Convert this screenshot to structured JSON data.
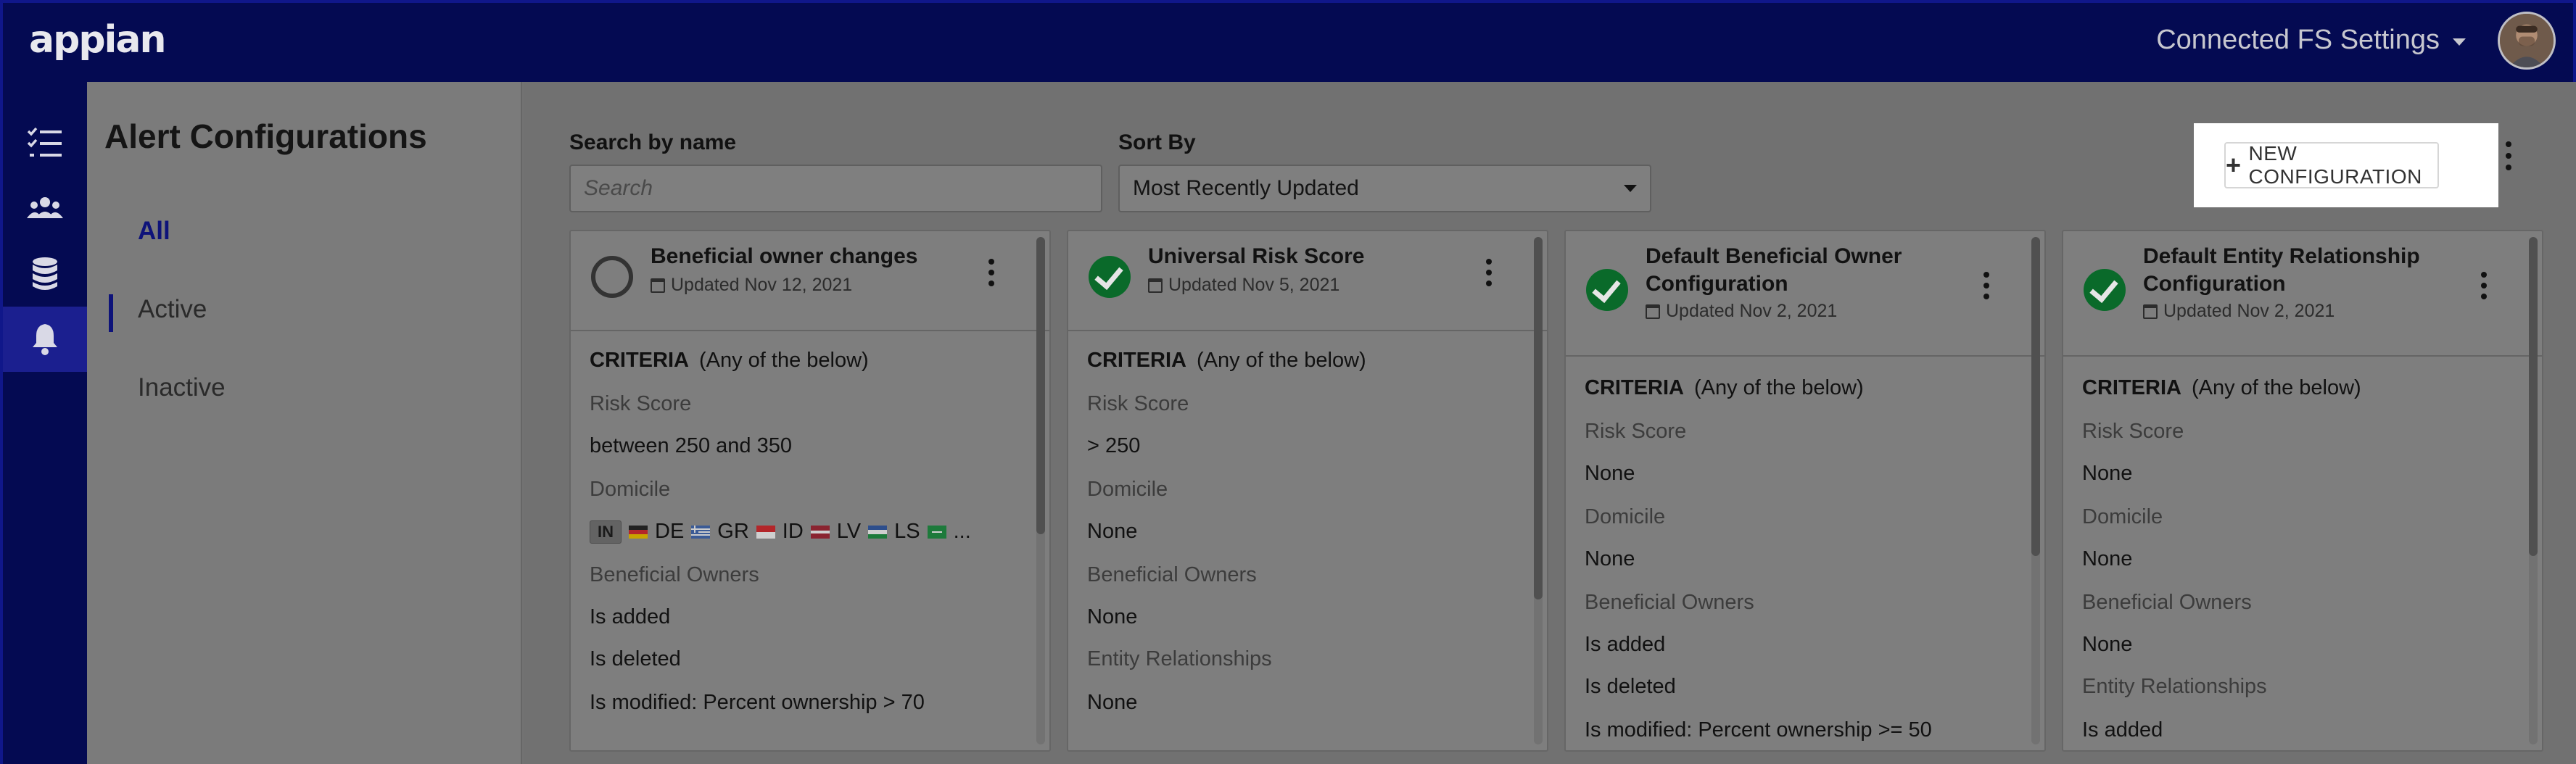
{
  "header": {
    "logo": "appian",
    "settings_label": "Connected FS Settings"
  },
  "rail": {
    "items": [
      {
        "icon": "checklist-icon",
        "active": false
      },
      {
        "icon": "users-icon",
        "active": false
      },
      {
        "icon": "database-icon",
        "active": false
      },
      {
        "icon": "bell-icon",
        "active": true
      }
    ]
  },
  "leftnav": {
    "title": "Alert Configurations",
    "items": [
      {
        "label": "All",
        "selected": true
      },
      {
        "label": "Active",
        "selected": false
      },
      {
        "label": "Inactive",
        "selected": false
      }
    ]
  },
  "toolbar": {
    "search_label": "Search by name",
    "search_placeholder": "Search",
    "sort_label": "Sort By",
    "sort_value": "Most Recently Updated",
    "new_button_label": "NEW CONFIGURATION"
  },
  "cards": [
    {
      "title": "Beneficial owner changes",
      "status": "inactive",
      "updated": "Updated Nov 12, 2021",
      "criteria_label": "CRITERIA",
      "criteria_qualifier": "(Any of the below)",
      "sections": [
        {
          "heading": "Risk Score",
          "values": [
            "between 250 and 350"
          ]
        },
        {
          "heading": "Domicile",
          "flags": [
            "IN",
            "DE",
            "GR",
            "ID",
            "LV",
            "LS",
            "..."
          ]
        },
        {
          "heading": "Beneficial Owners",
          "values": [
            "Is added",
            "Is deleted",
            "Is modified: Percent ownership > 70"
          ]
        }
      ]
    },
    {
      "title": "Universal Risk Score",
      "status": "active",
      "updated": "Updated Nov 5, 2021",
      "criteria_label": "CRITERIA",
      "criteria_qualifier": "(Any of the below)",
      "sections": [
        {
          "heading": "Risk Score",
          "values": [
            "> 250"
          ]
        },
        {
          "heading": "Domicile",
          "values": [
            "None"
          ]
        },
        {
          "heading": "Beneficial Owners",
          "values": [
            "None"
          ]
        },
        {
          "heading": "Entity Relationships",
          "values": [
            "None"
          ]
        }
      ]
    },
    {
      "title": "Default Beneficial Owner Configuration",
      "status": "active",
      "updated": "Updated Nov 2, 2021",
      "criteria_label": "CRITERIA",
      "criteria_qualifier": "(Any of the below)",
      "sections": [
        {
          "heading": "Risk Score",
          "values": [
            "None"
          ]
        },
        {
          "heading": "Domicile",
          "values": [
            "None"
          ]
        },
        {
          "heading": "Beneficial Owners",
          "values": [
            "Is added",
            "Is deleted",
            "Is modified: Percent ownership >= 50"
          ]
        }
      ]
    },
    {
      "title": "Default Entity Relationship Configuration",
      "status": "active",
      "updated": "Updated Nov 2, 2021",
      "criteria_label": "CRITERIA",
      "criteria_qualifier": "(Any of the below)",
      "sections": [
        {
          "heading": "Risk Score",
          "values": [
            "None"
          ]
        },
        {
          "heading": "Domicile",
          "values": [
            "None"
          ]
        },
        {
          "heading": "Beneficial Owners",
          "values": [
            "None"
          ]
        },
        {
          "heading": "Entity Relationships",
          "values": [
            "Is added"
          ]
        }
      ]
    }
  ]
}
